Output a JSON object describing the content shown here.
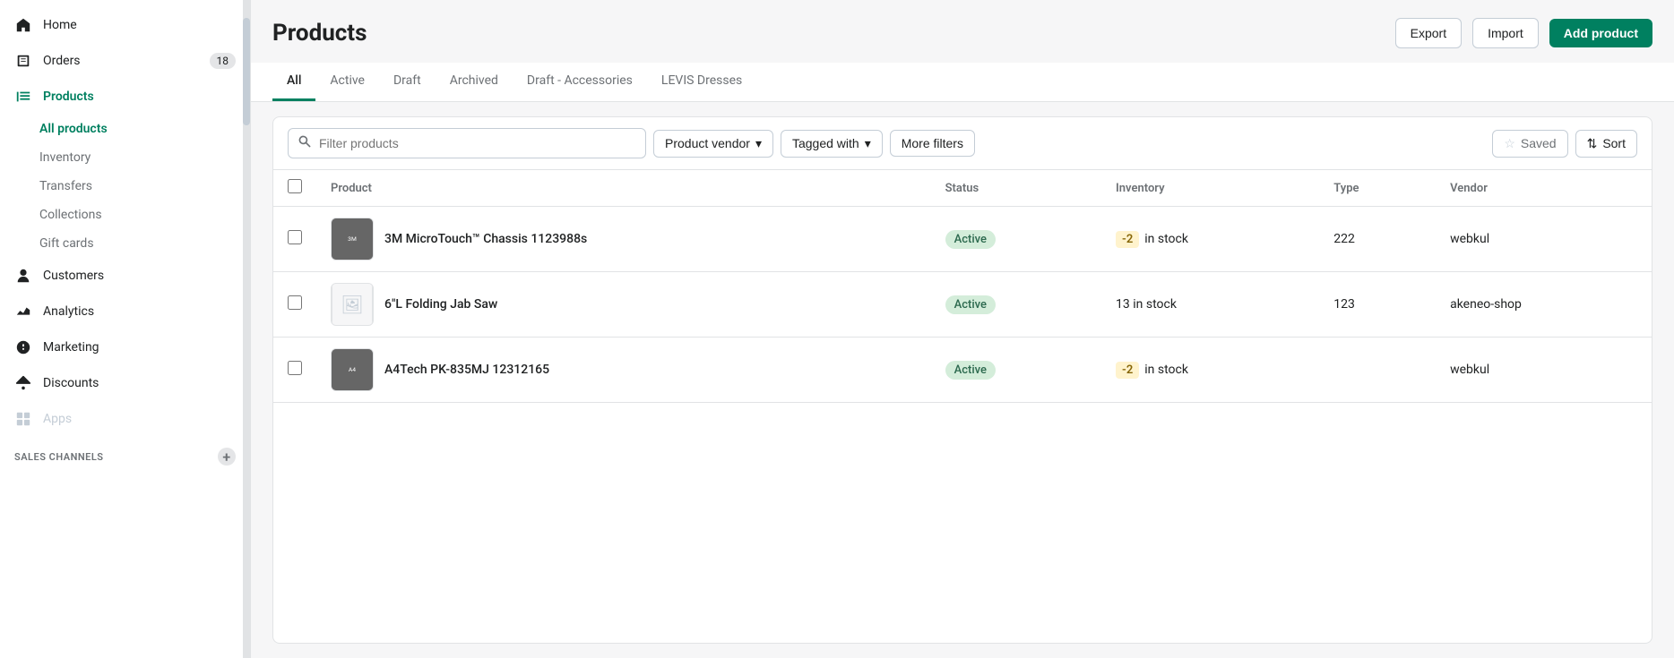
{
  "sidebar": {
    "items": [
      {
        "id": "home",
        "label": "Home",
        "icon": "home",
        "active": false
      },
      {
        "id": "orders",
        "label": "Orders",
        "icon": "orders",
        "active": false,
        "badge": "18"
      },
      {
        "id": "products",
        "label": "Products",
        "icon": "products",
        "active": true
      },
      {
        "id": "customers",
        "label": "Customers",
        "icon": "customers",
        "active": false
      },
      {
        "id": "analytics",
        "label": "Analytics",
        "icon": "analytics",
        "active": false
      },
      {
        "id": "marketing",
        "label": "Marketing",
        "icon": "marketing",
        "active": false
      },
      {
        "id": "discounts",
        "label": "Discounts",
        "icon": "discounts",
        "active": false
      },
      {
        "id": "apps",
        "label": "Apps",
        "icon": "apps",
        "active": false
      }
    ],
    "products_subnav": [
      {
        "id": "all-products",
        "label": "All products",
        "active": true
      },
      {
        "id": "inventory",
        "label": "Inventory",
        "active": false
      },
      {
        "id": "transfers",
        "label": "Transfers",
        "active": false
      },
      {
        "id": "collections",
        "label": "Collections",
        "active": false
      },
      {
        "id": "gift-cards",
        "label": "Gift cards",
        "active": false
      }
    ],
    "sales_channels_label": "SALES CHANNELS"
  },
  "page": {
    "title": "Products",
    "export_label": "Export",
    "import_label": "Import",
    "add_product_label": "Add product"
  },
  "tabs": [
    {
      "id": "all",
      "label": "All",
      "active": true
    },
    {
      "id": "active",
      "label": "Active",
      "active": false
    },
    {
      "id": "draft",
      "label": "Draft",
      "active": false
    },
    {
      "id": "archived",
      "label": "Archived",
      "active": false
    },
    {
      "id": "draft-accessories",
      "label": "Draft - Accessories",
      "active": false
    },
    {
      "id": "levis-dresses",
      "label": "LEVIS Dresses",
      "active": false
    }
  ],
  "filters": {
    "search_placeholder": "Filter products",
    "product_vendor_label": "Product vendor",
    "tagged_with_label": "Tagged with",
    "more_filters_label": "More filters",
    "saved_label": "Saved",
    "sort_label": "Sort"
  },
  "table": {
    "columns": [
      {
        "id": "product",
        "label": "Product"
      },
      {
        "id": "status",
        "label": "Status"
      },
      {
        "id": "inventory",
        "label": "Inventory"
      },
      {
        "id": "type",
        "label": "Type"
      },
      {
        "id": "vendor",
        "label": "Vendor"
      }
    ],
    "rows": [
      {
        "id": "row1",
        "name": "3M MicroTouch™ Chassis 1123988s",
        "status": "Active",
        "inventory_badge": "-2",
        "inventory_text": "in stock",
        "type": "222",
        "vendor": "webkul",
        "has_image": true
      },
      {
        "id": "row2",
        "name": "6\"L Folding Jab Saw",
        "status": "Active",
        "inventory_badge": null,
        "inventory_text": "13 in stock",
        "type": "123",
        "vendor": "akeneo-shop",
        "has_image": false
      },
      {
        "id": "row3",
        "name": "A4Tech PK-835MJ 12312165",
        "status": "Active",
        "inventory_badge": "-2",
        "inventory_text": "in stock",
        "type": "",
        "vendor": "webkul",
        "has_image": true
      }
    ]
  }
}
